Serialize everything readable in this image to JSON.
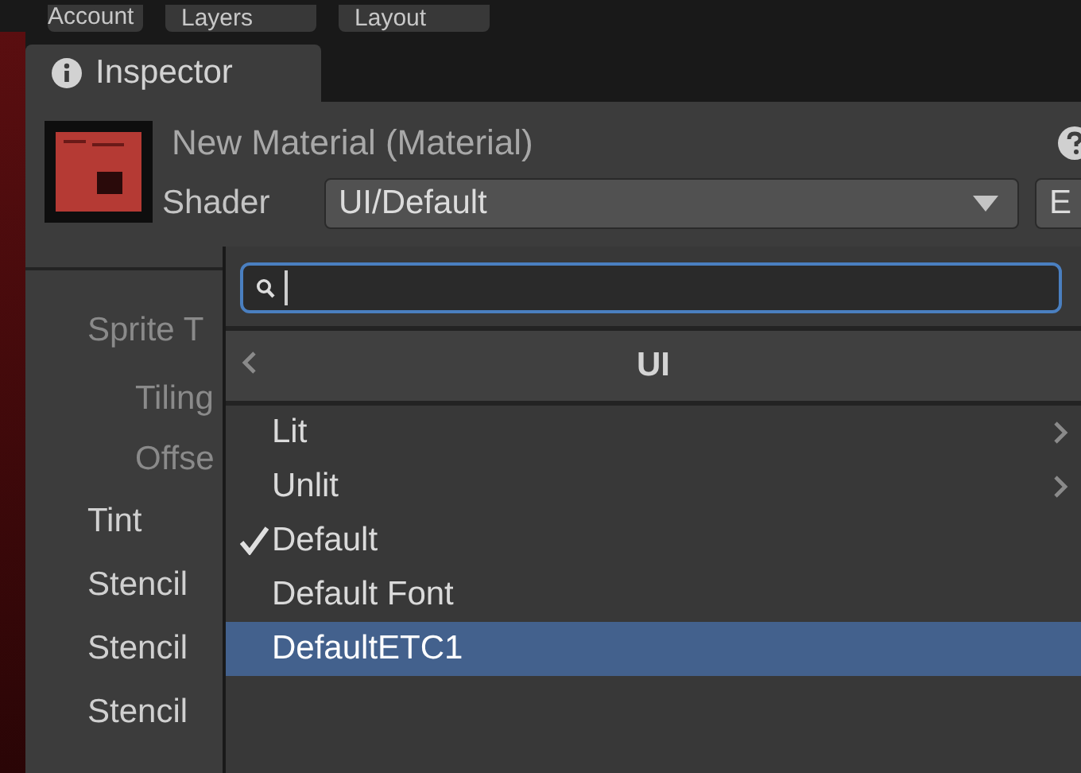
{
  "toolbar": {
    "buttons": [
      {
        "label": "Account"
      },
      {
        "label": "Layers"
      },
      {
        "label": "Layout"
      }
    ]
  },
  "tab": {
    "label": "Inspector",
    "selected": true
  },
  "header": {
    "title": "New Material (Material)",
    "shader_label": "Shader",
    "shader_value": "UI/Default",
    "edit_button": "E"
  },
  "properties": [
    {
      "label": "Sprite T",
      "indented": false,
      "dimmed": true
    },
    {
      "label": "Tiling",
      "indented": true,
      "dimmed": true
    },
    {
      "label": "Offse",
      "indented": true,
      "dimmed": true
    },
    {
      "label": "Tint",
      "indented": false,
      "dimmed": false
    },
    {
      "label": "Stencil",
      "indented": false,
      "dimmed": false
    },
    {
      "label": "Stencil",
      "indented": false,
      "dimmed": false
    },
    {
      "label": "Stencil",
      "indented": false,
      "dimmed": false
    }
  ],
  "popup": {
    "category": "UI",
    "items": [
      {
        "label": "Lit",
        "submenu": true,
        "checked": false,
        "selected": false
      },
      {
        "label": "Unlit",
        "submenu": true,
        "checked": false,
        "selected": false
      },
      {
        "label": "Default",
        "submenu": false,
        "checked": true,
        "selected": false
      },
      {
        "label": "Default Font",
        "submenu": false,
        "checked": false,
        "selected": false
      },
      {
        "label": "DefaultETC1",
        "submenu": false,
        "checked": false,
        "selected": true
      }
    ]
  }
}
